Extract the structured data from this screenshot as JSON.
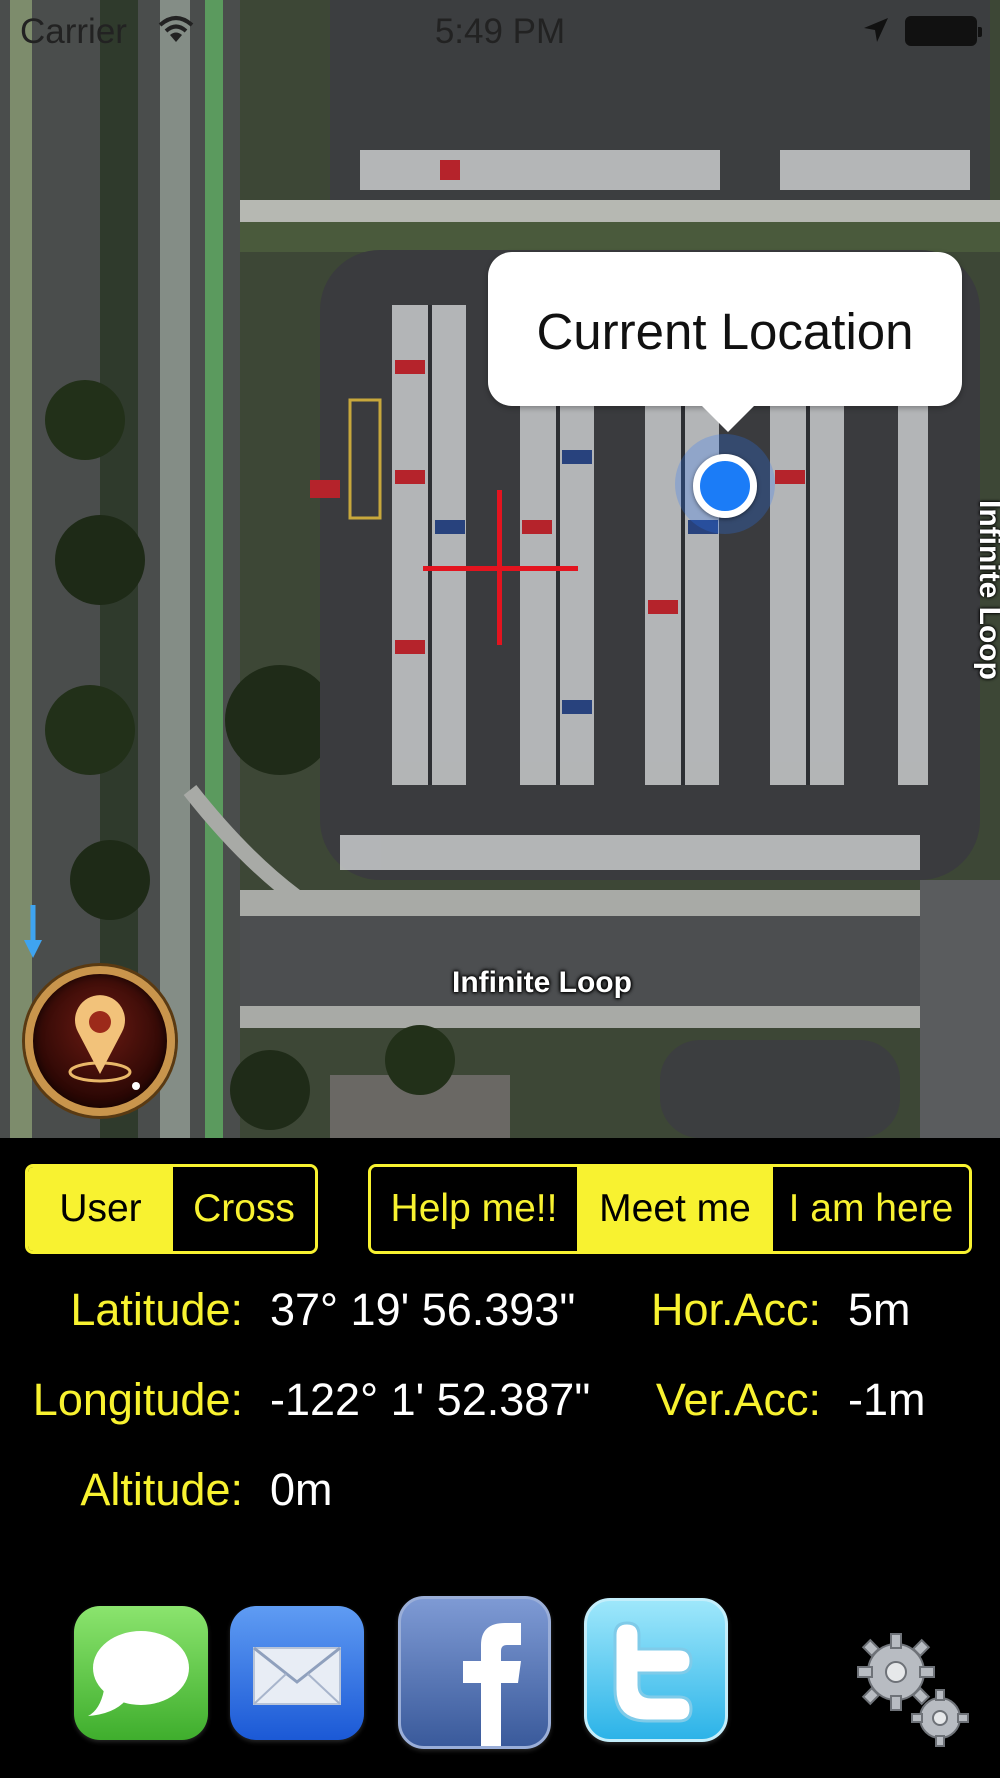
{
  "status_bar": {
    "carrier": "Carrier",
    "time": "5:49 PM",
    "icons": [
      "wifi-icon",
      "location-arrow-icon",
      "battery-icon"
    ]
  },
  "map": {
    "callout_title": "Current Location",
    "road_label": "Infinite Loop",
    "road_label_vertical": "Infinite Loop",
    "crosshair_color": "#e3141f",
    "user_dot_color": "#1b7cf7",
    "pin_button_icon": "map-pin-icon"
  },
  "mode_toggle": {
    "items": [
      {
        "label": "User",
        "active": true
      },
      {
        "label": "Cross",
        "active": false
      }
    ]
  },
  "action_bar": {
    "items": [
      {
        "label": "Help me!!",
        "active": false
      },
      {
        "label": "Meet me",
        "active": true
      },
      {
        "label": "I am here",
        "active": false
      }
    ]
  },
  "info": {
    "latitude_label": "Latitude:",
    "latitude_value": "37° 19' 56.393\"",
    "longitude_label": "Longitude:",
    "longitude_value": "-122° 1' 52.387\"",
    "altitude_label": "Altitude:",
    "altitude_value": "0m",
    "hor_acc_label": "Hor.Acc:",
    "hor_acc_value": "5m",
    "ver_acc_label": "Ver.Acc:",
    "ver_acc_value": "-1m"
  },
  "share_bar": {
    "icons": [
      "messages-icon",
      "mail-icon",
      "facebook-icon",
      "twitter-icon",
      "settings-gear-icon"
    ]
  },
  "colors": {
    "accent_yellow": "#f8f230",
    "background": "#000000"
  }
}
